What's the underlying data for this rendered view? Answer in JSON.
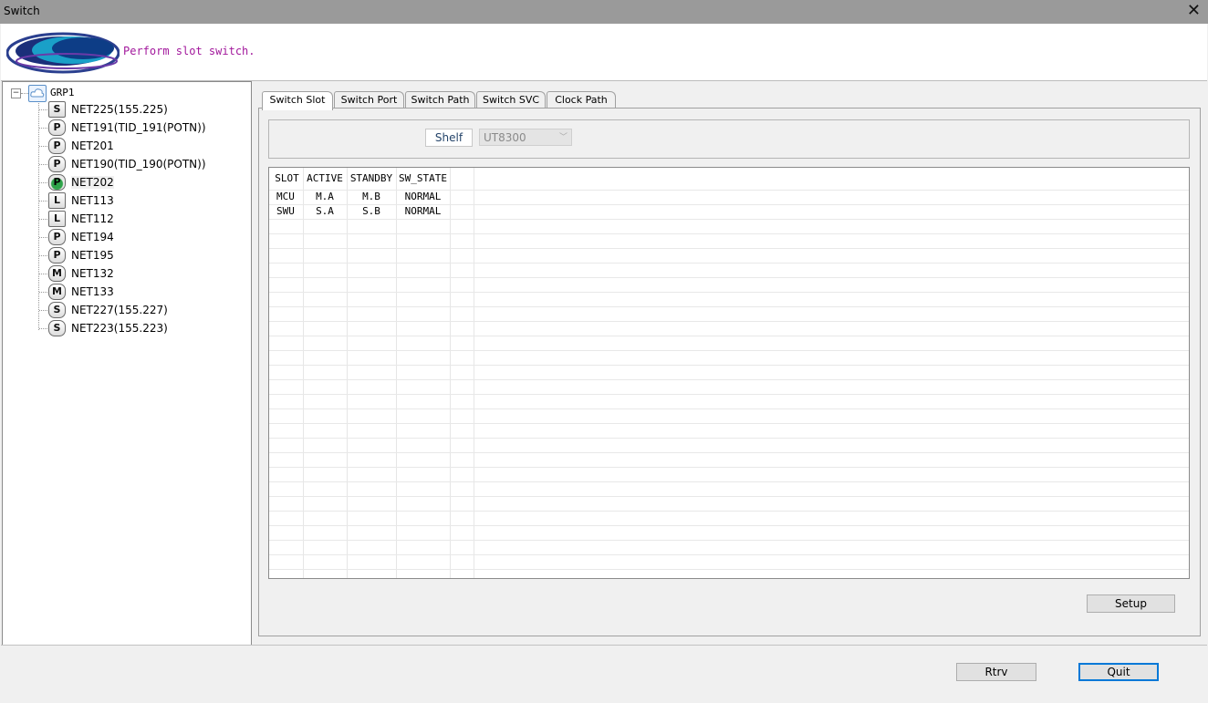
{
  "window": {
    "title": "Switch",
    "close_glyph": "✕"
  },
  "header": {
    "message": "Perform slot switch.",
    "logo_icon": "logo-swirl"
  },
  "tree": {
    "root": {
      "label": "GRP1",
      "expander": "−",
      "icon": "cloud-icon"
    },
    "nodes": [
      {
        "label": "NET225(155.225)",
        "badge": "S"
      },
      {
        "label": "NET191(TID_191(POTN))",
        "badge": "P"
      },
      {
        "label": "NET201",
        "badge": "P"
      },
      {
        "label": "NET190(TID_190(POTN))",
        "badge": "P"
      },
      {
        "label": "NET202",
        "badge": "P",
        "selected": true
      },
      {
        "label": "NET113",
        "badge": "L"
      },
      {
        "label": "NET112",
        "badge": "L"
      },
      {
        "label": "NET194",
        "badge": "P"
      },
      {
        "label": "NET195",
        "badge": "P"
      },
      {
        "label": "NET132",
        "badge": "M"
      },
      {
        "label": "NET133",
        "badge": "M"
      },
      {
        "label": "NET227(155.227)",
        "badge": "S"
      },
      {
        "label": "NET223(155.223)",
        "badge": "S"
      }
    ]
  },
  "tabs": [
    {
      "label": "Switch Slot",
      "active": true
    },
    {
      "label": "Switch Port"
    },
    {
      "label": "Switch Path"
    },
    {
      "label": "Switch SVC"
    },
    {
      "label": "Clock Path"
    }
  ],
  "shelf": {
    "label": "Shelf",
    "value": "UT8300"
  },
  "grid": {
    "columns": [
      "SLOT",
      "ACTIVE",
      "STANDBY",
      "SW_STATE"
    ],
    "rows": [
      [
        "MCU",
        "M.A",
        "M.B",
        "NORMAL"
      ],
      [
        "SWU",
        "S.A",
        "S.B",
        "NORMAL"
      ]
    ]
  },
  "buttons": {
    "setup": "Setup",
    "rtrv": "Rtrv",
    "quit": "Quit"
  }
}
